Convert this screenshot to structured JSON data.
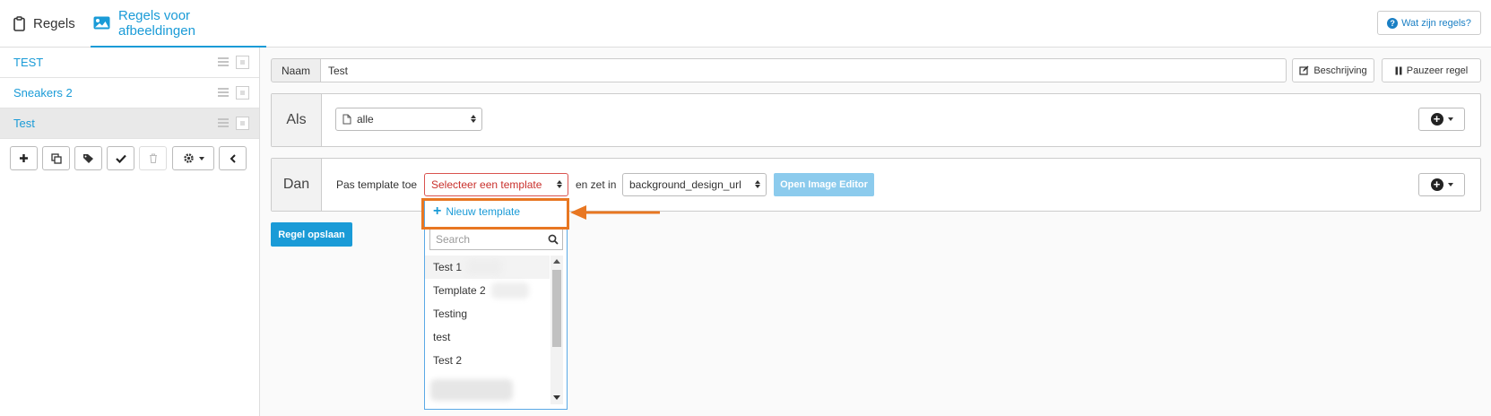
{
  "nav": {
    "tab_rules": "Regels",
    "tab_images": "Regels voor afbeeldingen",
    "help_button": "Wat zijn regels?"
  },
  "sidebar": {
    "rules": [
      {
        "label": "TEST"
      },
      {
        "label": "Sneakers 2"
      },
      {
        "label": "Test",
        "active": true
      }
    ],
    "toolbar_icons": [
      "plus-icon",
      "copy-icon",
      "tags-icon",
      "check-icon",
      "trash-icon",
      "gear-icon",
      "chevron-left-icon"
    ]
  },
  "header": {
    "name_label": "Naam",
    "name_value": "Test",
    "description_button": "Beschrijving",
    "pause_button": "Pauzeer regel"
  },
  "condition": {
    "label": "Als",
    "select_value": "alle"
  },
  "action": {
    "label": "Dan",
    "apply_text": "Pas template toe",
    "template_select": "Selecteer een template",
    "set_in_text": "en zet in",
    "field_select": "background_design_url",
    "editor_button": "Open Image Editor"
  },
  "save_button": "Regel opslaan",
  "dropdown": {
    "new_template": "Nieuw template",
    "search_placeholder": "Search",
    "options": [
      "Test 1",
      "Template 2",
      "Testing",
      "test",
      "Test 2"
    ]
  },
  "colors": {
    "accent": "#1a9bd7",
    "error": "#d9534f",
    "highlight": "#e87722"
  }
}
